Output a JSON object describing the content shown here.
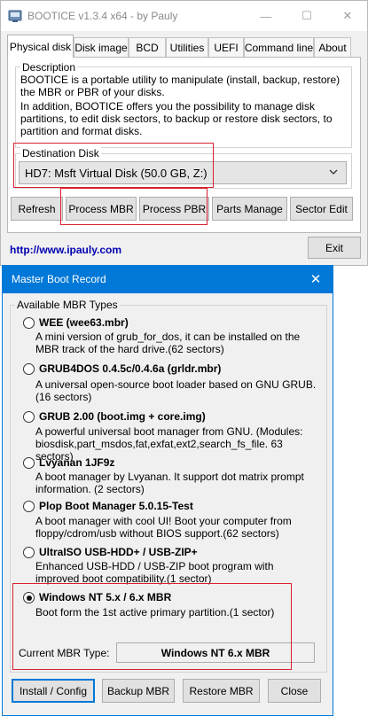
{
  "bootice": {
    "title": "BOOTICE v1.3.4 x64 - by Pauly",
    "controls": {
      "minimize": "—",
      "maximize": "☐",
      "close": "✕"
    },
    "tabs": [
      "Physical disk",
      "Disk image",
      "BCD",
      "Utilities",
      "UEFI",
      "Command line",
      "About"
    ],
    "description_label": "Description",
    "description_p1": "BOOTICE is a portable utility to manipulate (install, backup, restore) the MBR or PBR of your disks.",
    "description_p2": "In addition, BOOTICE offers you the possibility to manage disk partitions, to edit disk sectors, to backup or restore disk sectors, to partition and format disks.",
    "destination_label": "Destination Disk",
    "destination_value": "HD7: Msft Virtual Disk (50.0 GB, Z:)",
    "buttons": [
      "Refresh",
      "Process MBR",
      "Process PBR",
      "Parts Manage",
      "Sector Edit"
    ],
    "link": "http://www.ipauly.com",
    "exit": "Exit"
  },
  "mbr_dialog": {
    "title": "Master Boot Record",
    "close_glyph": "✕",
    "group_label": "Available MBR Types",
    "options": [
      {
        "title": "WEE (wee63.mbr)",
        "desc": "A mini version of grub_for_dos, it can be installed on the MBR track of the hard drive.(62 sectors)",
        "selected": false
      },
      {
        "title": "GRUB4DOS 0.4.5c/0.4.6a (grldr.mbr)",
        "desc": "A universal open-source boot loader based on GNU GRUB.(16 sectors)",
        "selected": false
      },
      {
        "title": "GRUB 2.00 (boot.img + core.img)",
        "desc": "A powerful universal boot manager from GNU. (Modules: biosdisk,part_msdos,fat,exfat,ext2,search_fs_file. 63 sectors)",
        "selected": false
      },
      {
        "title": "Lvyanan 1JF9z",
        "desc": "A boot manager by Lvyanan. It support dot matrix prompt information. (2 sectors)",
        "selected": false
      },
      {
        "title": "Plop Boot Manager 5.0.15-Test",
        "desc": "A boot manager with cool UI! Boot your computer from floppy/cdrom/usb without BIOS support.(62 sectors)",
        "selected": false
      },
      {
        "title": "UltraISO USB-HDD+ / USB-ZIP+",
        "desc": "Enhanced USB-HDD / USB-ZIP boot program with improved boot compatibility.(1 sector)",
        "selected": false
      },
      {
        "title": "Windows NT 5.x / 6.x MBR",
        "desc": "Boot form the 1st active primary partition.(1 sector)",
        "selected": true
      }
    ],
    "current_label": "Current MBR Type:",
    "current_value": "Windows NT 6.x MBR",
    "buttons": [
      "Install / Config",
      "Backup MBR",
      "Restore MBR",
      "Close"
    ]
  },
  "colors": {
    "accent": "#0078d7",
    "highlight": "#d8202f",
    "link": "#0000b0"
  }
}
